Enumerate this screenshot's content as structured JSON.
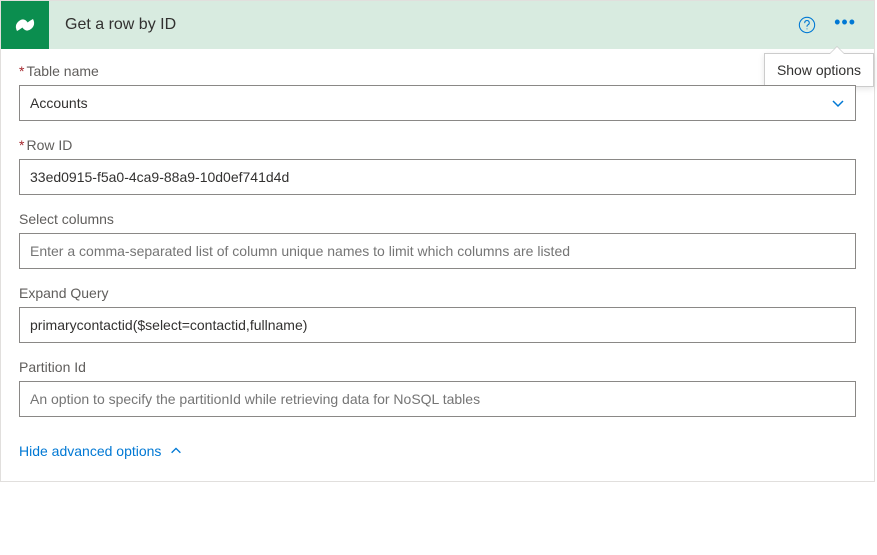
{
  "header": {
    "title": "Get a row by ID",
    "tooltip": "Show options"
  },
  "fields": {
    "tableName": {
      "label": "Table name",
      "required": true,
      "value": "Accounts"
    },
    "rowId": {
      "label": "Row ID",
      "required": true,
      "value": "33ed0915-f5a0-4ca9-88a9-10d0ef741d4d"
    },
    "selectColumns": {
      "label": "Select columns",
      "placeholder": "Enter a comma-separated list of column unique names to limit which columns are listed",
      "value": ""
    },
    "expandQuery": {
      "label": "Expand Query",
      "value": "primarycontactid($select=contactid,fullname)"
    },
    "partitionId": {
      "label": "Partition Id",
      "placeholder": "An option to specify the partitionId while retrieving data for NoSQL tables",
      "value": ""
    }
  },
  "advancedToggle": "Hide advanced options"
}
